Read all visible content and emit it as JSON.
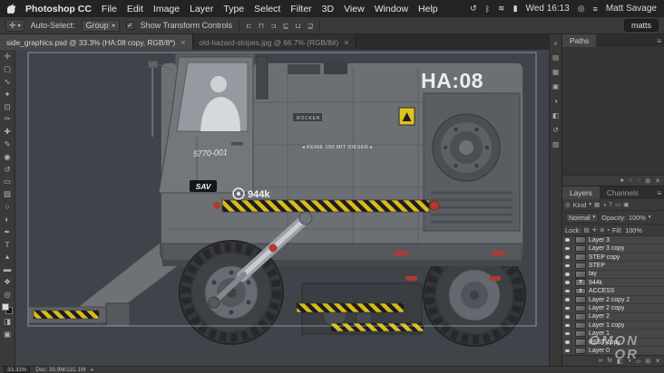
{
  "menu_bar": {
    "app_menu": "Photoshop CC",
    "items": [
      "File",
      "Edit",
      "Image",
      "Layer",
      "Type",
      "Select",
      "Filter",
      "3D",
      "View",
      "Window",
      "Help"
    ],
    "status_icons": [
      {
        "name": "sync-icon",
        "glyph": "↺"
      },
      {
        "name": "bluetooth-icon",
        "glyph": "ᛒ"
      },
      {
        "name": "wifi-icon",
        "glyph": "≋"
      },
      {
        "name": "battery-icon",
        "glyph": "▮"
      },
      {
        "name": "spotlight-icon",
        "glyph": "◎"
      },
      {
        "name": "notification-center-icon",
        "glyph": "≡"
      }
    ],
    "time": "Wed 16:13",
    "user": "Matt Savage"
  },
  "options_bar": {
    "auto_select_label": "Auto-Select:",
    "auto_select_value": "Group",
    "transform_label": "Show Transform Controls",
    "align_icons": [
      {
        "name": "align-left-edges-icon",
        "glyph": "⊏"
      },
      {
        "name": "align-h-centers-icon",
        "glyph": "⊓"
      },
      {
        "name": "align-right-edges-icon",
        "glyph": "⊐"
      },
      {
        "name": "align-top-edges-icon",
        "glyph": "⊑"
      },
      {
        "name": "align-v-centers-icon",
        "glyph": "⊔"
      },
      {
        "name": "align-bottom-edges-icon",
        "glyph": "⊒"
      }
    ],
    "workspace": "matts"
  },
  "tab_bar": {
    "tabs": [
      {
        "label": "side_graphics.psd @ 33.3% (HA:08 copy, RGB/8*)"
      },
      {
        "label": "old-hazard-stripes.jpg @ 66.7% (RGB/8#)"
      }
    ]
  },
  "tools": [
    {
      "name": "move-tool",
      "glyph": "✛"
    },
    {
      "name": "marquee-tool",
      "glyph": "▢"
    },
    {
      "name": "lasso-tool",
      "glyph": "∿"
    },
    {
      "name": "magic-wand-tool",
      "glyph": "✦"
    },
    {
      "name": "crop-tool",
      "glyph": "⊡"
    },
    {
      "name": "eyedropper-tool",
      "glyph": "✑"
    },
    {
      "name": "healing-brush-tool",
      "glyph": "✚"
    },
    {
      "name": "brush-tool",
      "glyph": "✎"
    },
    {
      "name": "clone-stamp-tool",
      "glyph": "◉"
    },
    {
      "name": "history-brush-tool",
      "glyph": "↺"
    },
    {
      "name": "eraser-tool",
      "glyph": "▭"
    },
    {
      "name": "gradient-tool",
      "glyph": "▨"
    },
    {
      "name": "blur-tool",
      "glyph": "○"
    },
    {
      "name": "dodge-tool",
      "glyph": "◐"
    },
    {
      "name": "pen-tool",
      "glyph": "✒"
    },
    {
      "name": "type-tool",
      "glyph": "T"
    },
    {
      "name": "path-select-tool",
      "glyph": "▴"
    },
    {
      "name": "shape-tool",
      "glyph": "▬"
    },
    {
      "name": "hand-tool",
      "glyph": "❖"
    },
    {
      "name": "zoom-tool",
      "glyph": "◎"
    }
  ],
  "tools_extra": [
    {
      "name": "quick-mask-icon",
      "glyph": "◨"
    },
    {
      "name": "screen-mode-icon",
      "glyph": "▣"
    }
  ],
  "right_strip": [
    {
      "name": "collapse-panels-icon",
      "glyph": "«"
    },
    {
      "name": "color-panel-icon",
      "glyph": "▤"
    },
    {
      "name": "swatches-panel-icon",
      "glyph": "▦"
    },
    {
      "name": "libraries-panel-icon",
      "glyph": "▣"
    },
    {
      "name": "adjustments-panel-icon",
      "glyph": "◑"
    },
    {
      "name": "styles-panel-icon",
      "glyph": "◧"
    },
    {
      "name": "history-panel-icon",
      "glyph": "↺"
    },
    {
      "name": "properties-panel-icon",
      "glyph": "▥"
    }
  ],
  "paths_panel": {
    "title": "Paths",
    "bottom_icons": [
      {
        "name": "fill-path-icon",
        "glyph": "●"
      },
      {
        "name": "stroke-path-icon",
        "glyph": "○"
      },
      {
        "name": "path-selection-icon",
        "glyph": "◌"
      },
      {
        "name": "new-path-icon",
        "glyph": "⊞"
      },
      {
        "name": "delete-path-icon",
        "glyph": "✕"
      }
    ]
  },
  "layers_panel": {
    "tab_layers": "Layers",
    "tab_channels": "Channels",
    "kind_label": "Kind",
    "filter_icons": [
      {
        "name": "filter-pixel-icon",
        "glyph": "▦"
      },
      {
        "name": "filter-adjustment-icon",
        "glyph": "◑"
      },
      {
        "name": "filter-type-icon",
        "glyph": "T"
      },
      {
        "name": "filter-shape-icon",
        "glyph": "▭"
      },
      {
        "name": "filter-smart-icon",
        "glyph": "▣"
      }
    ],
    "blend_mode": "Normal",
    "opacity_label": "Opacity:",
    "opacity_value": "100%",
    "lock_label": "Lock:",
    "lock_icons": [
      {
        "name": "lock-transparency-icon",
        "glyph": "▨"
      },
      {
        "name": "lock-pixels-icon",
        "glyph": "✛"
      },
      {
        "name": "lock-position-icon",
        "glyph": "⊕"
      },
      {
        "name": "lock-all-icon",
        "glyph": "▪"
      }
    ],
    "fill_label": "Fill:",
    "fill_value": "100%",
    "layers": [
      {
        "name": "Layer 3",
        "type": "raster"
      },
      {
        "name": "Layer 3 copy",
        "type": "raster"
      },
      {
        "name": "STEP copy",
        "type": "raster"
      },
      {
        "name": "STEP",
        "type": "raster"
      },
      {
        "name": "lay",
        "type": "raster"
      },
      {
        "name": "944k",
        "type": "text"
      },
      {
        "name": "ACCESS",
        "type": "text"
      },
      {
        "name": "Layer 2 copy 2",
        "type": "raster"
      },
      {
        "name": "Layer 2 copy",
        "type": "raster"
      },
      {
        "name": "Layer 2",
        "type": "raster"
      },
      {
        "name": "Layer 1 copy",
        "type": "raster"
      },
      {
        "name": "Layer 1",
        "type": "raster"
      },
      {
        "name": "REST copy",
        "type": "raster"
      },
      {
        "name": "Layer 0",
        "type": "raster"
      }
    ],
    "bottom_icons": [
      {
        "name": "link-layers-icon",
        "glyph": "∞"
      },
      {
        "name": "layer-effects-icon",
        "glyph": "fx"
      },
      {
        "name": "layer-mask-icon",
        "glyph": "◧"
      },
      {
        "name": "adjustment-layer-icon",
        "glyph": "◑"
      },
      {
        "name": "layer-group-icon",
        "glyph": "▱"
      },
      {
        "name": "new-layer-icon",
        "glyph": "⊞"
      },
      {
        "name": "delete-layer-icon",
        "glyph": "✕"
      }
    ]
  },
  "canvas": {
    "artwork": {
      "ha_label": "HA:08",
      "serial": "5770-001",
      "badge": "SAV",
      "weight": "944k",
      "rocker": "ROCKER",
      "warning_text": "◂ KEINE 100 MIT DIESER ▸"
    },
    "watermark": {
      "line1": "OMON",
      "line2": "OR"
    }
  },
  "status_bar": {
    "zoom": "33.33%",
    "doc": "Doc: 35.9M/131.1M"
  },
  "icons": {
    "text_layer": "T",
    "close": "×",
    "dropdown": "▾",
    "check": "✓",
    "panel_menu": "≡",
    "doc_arrow": "▸",
    "search": "◎"
  }
}
